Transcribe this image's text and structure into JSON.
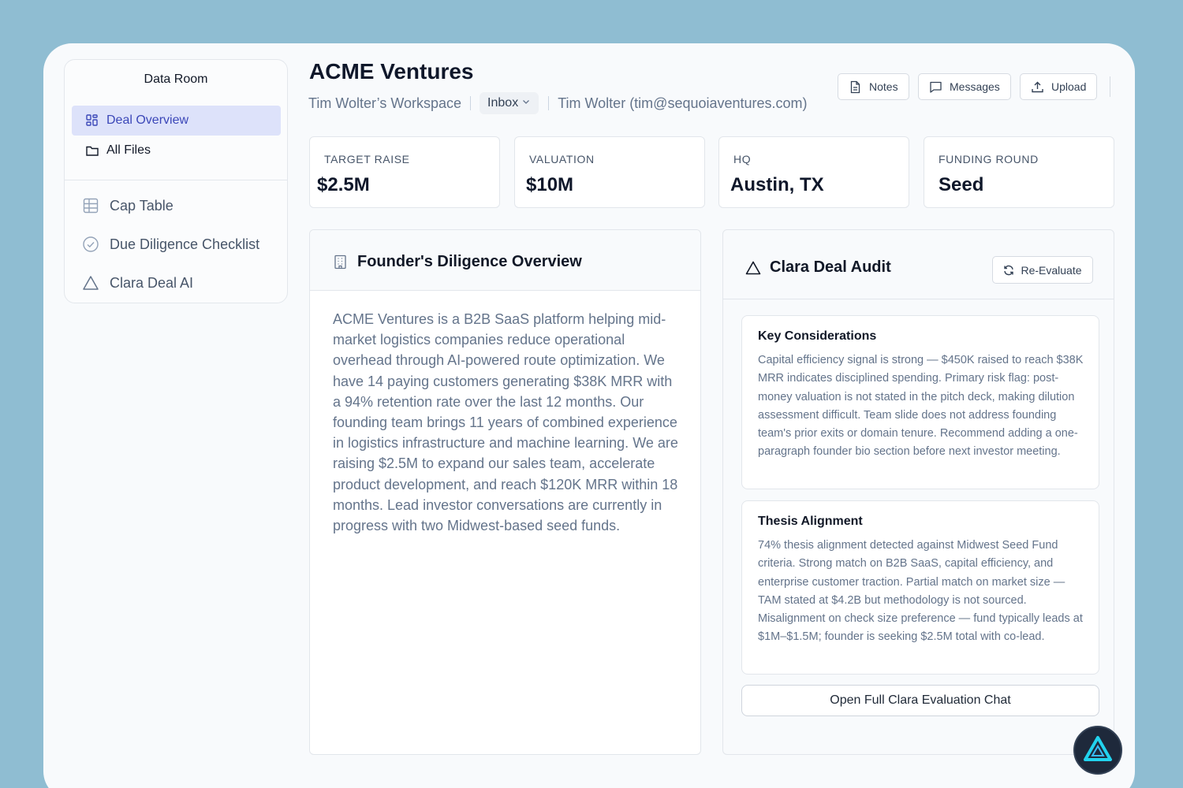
{
  "sidebar": {
    "title": "Data Room",
    "primary": [
      {
        "label": "Deal Overview",
        "icon": "grid-icon",
        "active": true
      },
      {
        "label": "All Files",
        "icon": "folder-icon",
        "active": false
      }
    ],
    "secondary": [
      {
        "label": "Cap Table",
        "icon": "table-icon"
      },
      {
        "label": "Due Diligence Checklist",
        "icon": "check-circle-icon"
      },
      {
        "label": "Clara Deal AI",
        "icon": "triangle-icon"
      }
    ]
  },
  "header": {
    "company": "ACME Ventures",
    "workspace": "Tim Wolter’s Workspace",
    "inbox": "Inbox",
    "user": "Tim Wolter (tim@sequoiaventures.com)",
    "buttons": {
      "notes": "Notes",
      "messages": "Messages",
      "upload": "Upload"
    }
  },
  "stats": [
    {
      "label": "TARGET RAISE",
      "value": "$2.5M"
    },
    {
      "label": "VALUATION",
      "value": "$10M"
    },
    {
      "label": "HQ",
      "value": "Austin, TX"
    },
    {
      "label": "FUNDING ROUND",
      "value": "Seed"
    }
  ],
  "founder": {
    "title": "Founder's Diligence Overview",
    "body": "ACME Ventures is a B2B SaaS platform helping mid-market logistics companies reduce operational overhead through AI-powered route optimization. We have 14 paying customers generating $38K MRR with a 94% retention rate over the last 12 months. Our founding team brings 11 years of combined experience in logistics infrastructure and machine learning. We are raising $2.5M to expand our sales team, accelerate product development, and reach $120K MRR within 18 months. Lead investor conversations are currently in progress with two Midwest-based seed funds."
  },
  "audit": {
    "title": "Clara Deal Audit",
    "reevaluate": "Re-Evaluate",
    "cards": [
      {
        "title": "Key Considerations",
        "body": "Capital efficiency signal is strong — $450K raised to reach $38K MRR indicates disciplined spending. Primary risk flag: post-money valuation is not stated in the pitch deck, making dilution assessment difficult. Team slide does not address founding team's prior exits or domain tenure. Recommend adding a one-paragraph founder bio section before next investor meeting."
      },
      {
        "title": "Thesis Alignment",
        "body": "74% thesis alignment detected against Midwest Seed Fund criteria. Strong match on B2B SaaS, capital efficiency, and enterprise customer traction. Partial match on market size — TAM stated at $4.2B but methodology is not sourced. Misalignment on check size preference — fund typically leads at $1M–$1.5M; founder is seeking $2.5M total with co-lead."
      }
    ],
    "open_chat": "Open Full Clara Evaluation Chat"
  },
  "colors": {
    "background": "#8fbdd2",
    "active_nav_bg": "#dde2fa",
    "active_nav_text": "#3b47b8",
    "fab_bg": "#1e293b",
    "fab_accent": "#22d3ee"
  }
}
